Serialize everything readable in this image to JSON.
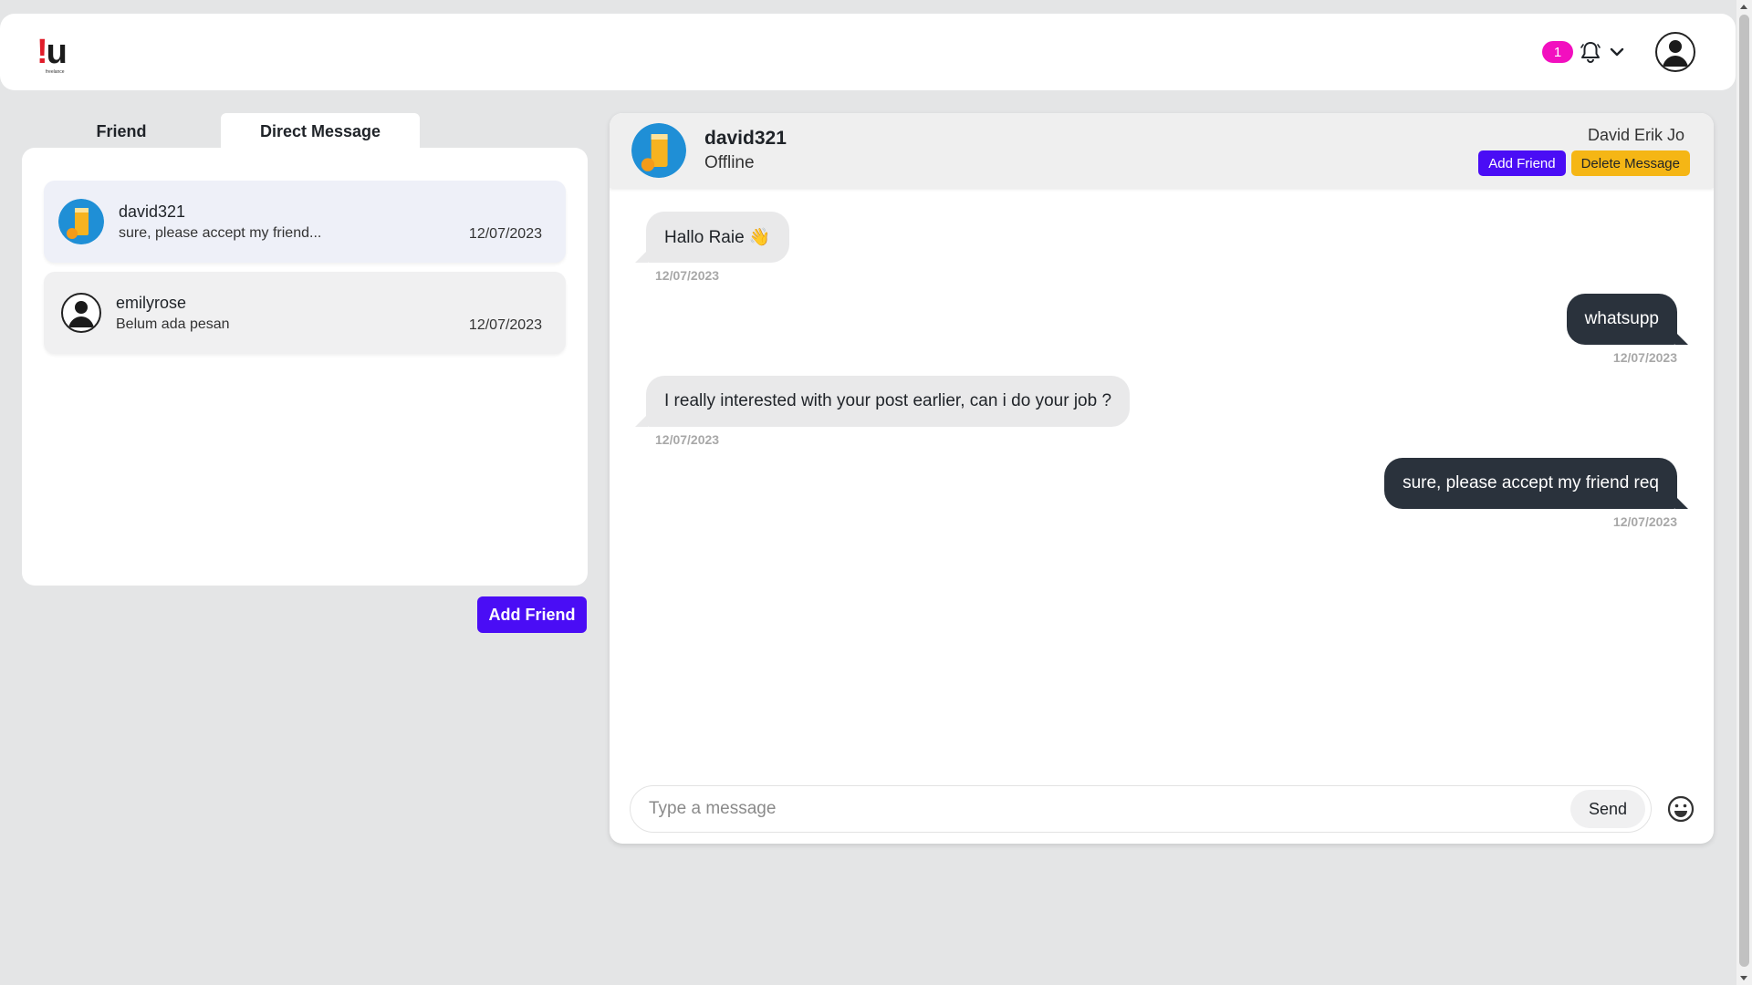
{
  "header": {
    "logo_mark": "!",
    "logo_letter": "u",
    "logo_sub": "freelance",
    "notification_count": "1"
  },
  "sidebar": {
    "tabs": [
      {
        "label": "Friend",
        "active": false
      },
      {
        "label": "Direct Message",
        "active": true
      }
    ],
    "conversations": [
      {
        "name": "david321",
        "preview": "sure, please accept my friend...",
        "date": "12/07/2023",
        "avatar": "juice-avatar",
        "selected": true
      },
      {
        "name": "emilyrose",
        "preview": "Belum ada pesan",
        "date": "12/07/2023",
        "avatar": "default-user-avatar",
        "selected": false
      }
    ],
    "add_friend_label": "Add Friend"
  },
  "chat": {
    "username": "david321",
    "status": "Offline",
    "full_name": "David Erik Jo",
    "add_friend_label": "Add Friend",
    "delete_message_label": "Delete Message",
    "messages": [
      {
        "direction": "in",
        "text": "Hallo Raie 👋",
        "date": "12/07/2023"
      },
      {
        "direction": "out",
        "text": "whatsupp",
        "date": "12/07/2023"
      },
      {
        "direction": "in",
        "text": "I really interested with your post earlier, can i do your job ?",
        "date": "12/07/2023"
      },
      {
        "direction": "out",
        "text": "sure, please accept my friend req",
        "date": "12/07/2023"
      }
    ],
    "composer": {
      "placeholder": "Type a message",
      "value": "",
      "send_label": "Send"
    }
  },
  "colors": {
    "accent_purple": "#4a0df5",
    "accent_yellow": "#f5b615",
    "badge_pink": "#f20fbf",
    "outgoing_bubble": "#2a323c",
    "incoming_bubble": "#e9e9ea"
  }
}
